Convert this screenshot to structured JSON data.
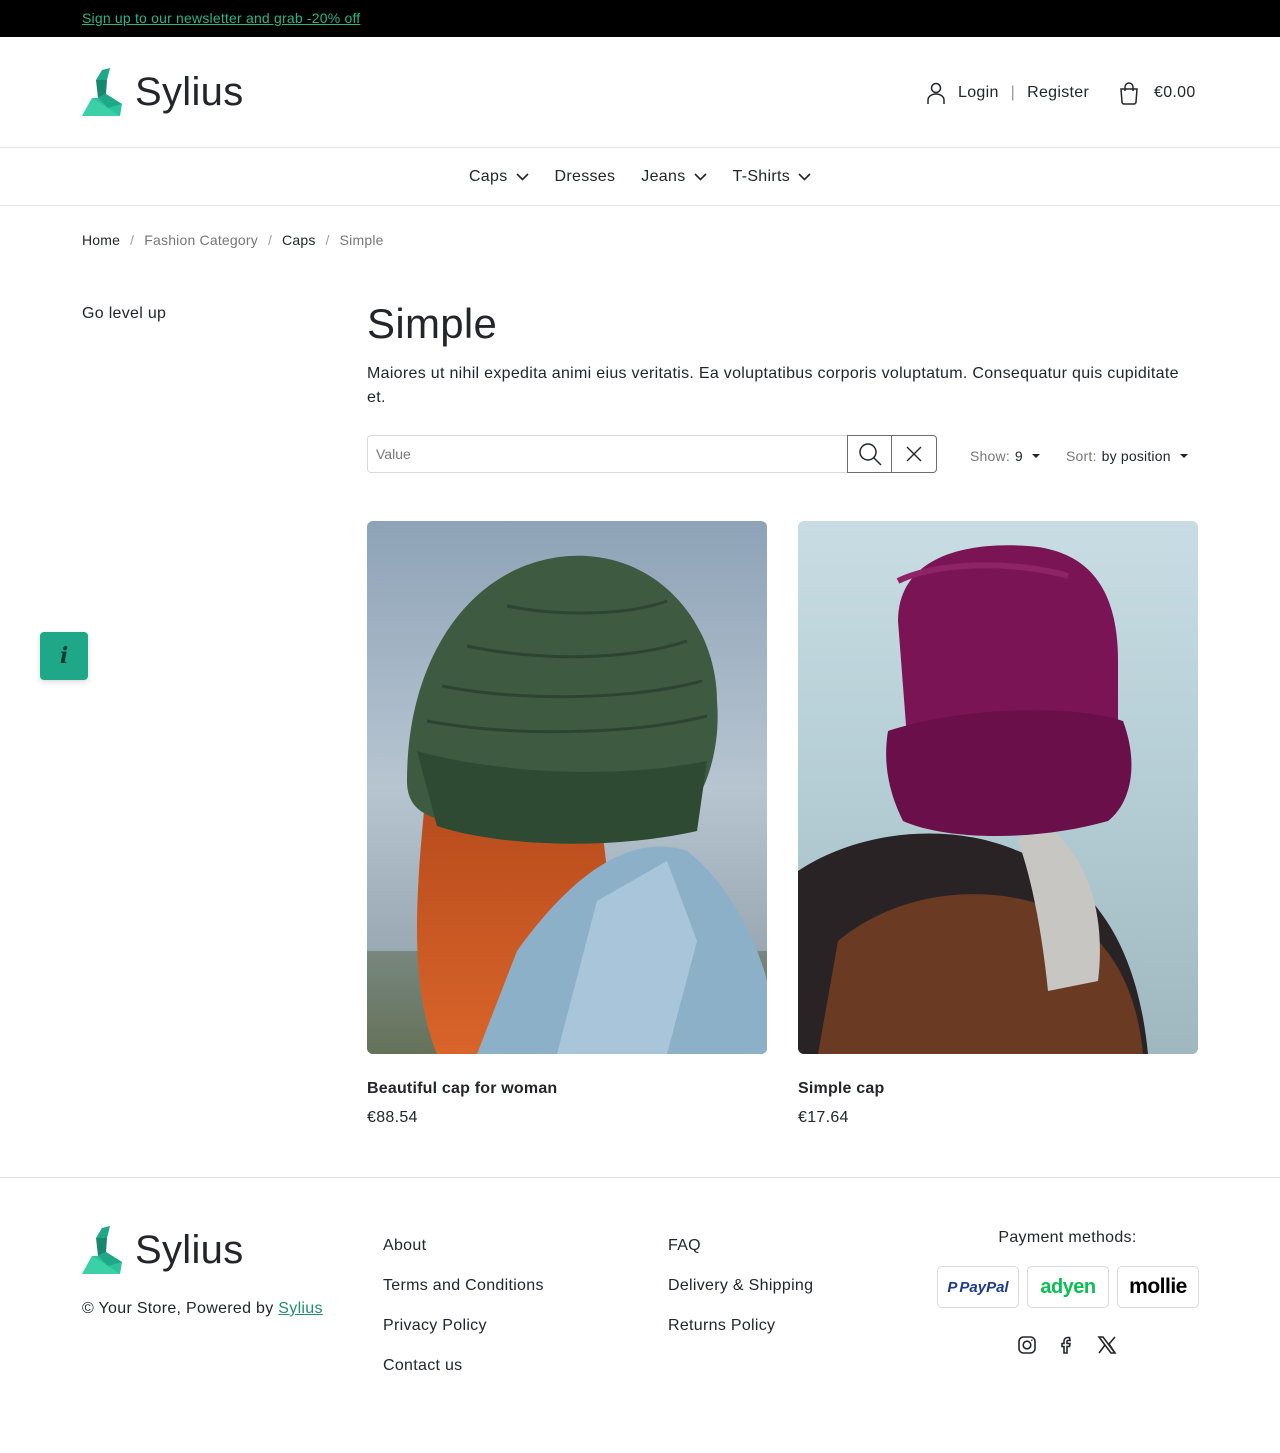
{
  "topbar": {
    "newsletter": "Sign up to our newsletter and grab -20% off"
  },
  "brand": {
    "name": "Sylius",
    "accent": "#1fa888"
  },
  "header": {
    "login": "Login",
    "separator": "|",
    "register": "Register",
    "cart_total": "€0.00"
  },
  "nav": {
    "items": [
      {
        "label": "Caps",
        "has_dropdown": true
      },
      {
        "label": "Dresses",
        "has_dropdown": false
      },
      {
        "label": "Jeans",
        "has_dropdown": true
      },
      {
        "label": "T-Shirts",
        "has_dropdown": true
      }
    ]
  },
  "breadcrumb": {
    "items": [
      "Home",
      "Fashion Category",
      "Caps",
      "Simple"
    ],
    "separator": "/"
  },
  "sidebar": {
    "level_up": "Go level up"
  },
  "info_button": {
    "glyph": "i"
  },
  "main": {
    "title": "Simple",
    "description": "Maiores ut nihil expedita animi eius veritatis. Ea voluptatibus corporis voluptatum. Consequatur quis cupiditate et.",
    "search": {
      "value": "",
      "placeholder": "Value"
    },
    "show": {
      "label": "Show:",
      "value": "9"
    },
    "sort": {
      "label": "Sort:",
      "value": "by position"
    }
  },
  "products": [
    {
      "name": "Beautiful cap for woman",
      "price": "€88.54",
      "image": "green-knit-beanie-photo"
    },
    {
      "name": "Simple cap",
      "price": "€17.64",
      "image": "purple-beanie-photo"
    }
  ],
  "footer": {
    "copyright_prefix": "© Your Store, Powered by ",
    "copyright_link": "Sylius",
    "links_col1": [
      "About",
      "Terms and Conditions",
      "Privacy Policy",
      "Contact us"
    ],
    "links_col2": [
      "FAQ",
      "Delivery & Shipping",
      "Returns Policy"
    ],
    "payments_title": "Payment methods:",
    "payment_methods": [
      "PayPal",
      "adyen",
      "mollie"
    ],
    "social": [
      "instagram-icon",
      "facebook-icon",
      "x-icon"
    ]
  }
}
